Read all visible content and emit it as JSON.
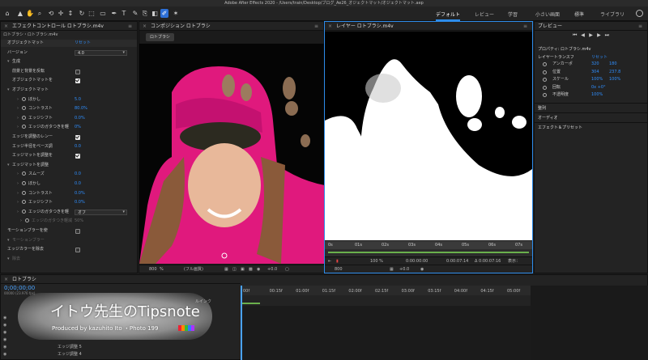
{
  "window": {
    "title": "Adobe After Effects 2020 - /Users/train/Desktop/ブログ_Ae26_オジェクトマット/オジェクトマット.aep"
  },
  "workspaces": [
    "デフォルト",
    "レビュー",
    "学習",
    "小さい画面",
    "標準",
    "ライブラリ"
  ],
  "effect_controls": {
    "tab": "エフェクトコントロール ロトブラシ.m4v",
    "breadcrumb": "ロトブラシ・ロトブラシ.m4v",
    "rows": [
      {
        "label": "オブジェクトマット",
        "value": "リセット",
        "kind": "blue"
      },
      {
        "label": "バージョン",
        "value": "4.0",
        "kind": "dropdown"
      },
      {
        "label": "生成",
        "value": "",
        "kind": "section"
      },
      {
        "label": "前景と背景を反転",
        "value": "",
        "kind": "check-off"
      },
      {
        "label": "オブジェクトマットを",
        "value": "",
        "kind": "check"
      },
      {
        "label": "オブジェクトマット",
        "value": "",
        "kind": "section"
      },
      {
        "label": "ぼかし",
        "value": "5.0",
        "kind": "blue"
      },
      {
        "label": "コントラスト",
        "value": "80.0%",
        "kind": "blue"
      },
      {
        "label": "エッジシフト",
        "value": "0.0%",
        "kind": "blue"
      },
      {
        "label": "エッジのガタつきを軽",
        "value": "0%",
        "kind": "blue"
      },
      {
        "label": "エッジを調整のレンー",
        "value": "",
        "kind": "check"
      },
      {
        "label": "エッジ半径をベース調",
        "value": "0.0",
        "kind": "blue"
      },
      {
        "label": "エッジマットを調整を",
        "value": "",
        "kind": "check"
      },
      {
        "label": "エッジマットを調整",
        "value": "",
        "kind": "section"
      },
      {
        "label": "スムーズ",
        "value": "0.0",
        "kind": "blue"
      },
      {
        "label": "ぼかし",
        "value": "0.0",
        "kind": "blue"
      },
      {
        "label": "コントラスト",
        "value": "0.0%",
        "kind": "blue"
      },
      {
        "label": "エッジシフト",
        "value": "0.0%",
        "kind": "blue"
      },
      {
        "label": "エッジのガタつきを軽",
        "value": "オフ",
        "kind": "dropdown"
      },
      {
        "label": "エッジのガタつき軽減",
        "value": "50%",
        "kind": "dim"
      },
      {
        "label": "モーションブラーを使",
        "value": "",
        "kind": "check-off"
      },
      {
        "label": "モーションブラー",
        "value": "",
        "kind": "dimsection"
      },
      {
        "label": "エッジカラーを除去",
        "value": "",
        "kind": "check-off"
      },
      {
        "label": "除去",
        "value": "",
        "kind": "dimsection"
      }
    ]
  },
  "composition": {
    "tab": "コンポジション ロトブラシ",
    "sub_tab": "ロトブラシ",
    "zoom": "800",
    "zoom_unit": "%",
    "quality": "(フル画質)",
    "exposure": "+0.0"
  },
  "layer_viewer": {
    "tab": "レイヤー ロトブラシ.m4v",
    "ruler": [
      "0s",
      "01s",
      "02s",
      "03s",
      "04s",
      "05s",
      "06s",
      "07s"
    ],
    "timecode_start": "0:00:00:00",
    "timecode_in": "0:00:07:14",
    "timecode_dur": "Δ 0:00:07:16",
    "view_label": "表示：",
    "zoom": "800",
    "zoom_pct": "100 %",
    "exposure": "+0.0"
  },
  "preview": {
    "tab": "プレビュー"
  },
  "properties": {
    "header": "プロパティ: ロトブラシ.m4v",
    "section": "レイヤートランスフ",
    "reset": "リセット",
    "rows": [
      {
        "label": "アンカーポ",
        "v1": "320",
        "v2": "180"
      },
      {
        "label": "位置",
        "v1": "304",
        "v2": "237.8"
      },
      {
        "label": "スケール",
        "v1": "100%",
        "v2": "100%"
      },
      {
        "label": "回転",
        "v1": "0x +0°",
        "v2": ""
      },
      {
        "label": "不透明度",
        "v1": "100%",
        "v2": ""
      }
    ],
    "panels": [
      "整列",
      "オーディオ",
      "エフェクト＆プリセット"
    ]
  },
  "timeline": {
    "tab": "ロトブラシ",
    "timecode": "0;00;00;00",
    "frame_info": "00000 (23.976 fps)",
    "ruler": [
      "00f",
      "00:15f",
      "01:00f",
      "01:15f",
      "02:00f",
      "02:15f",
      "03:00f",
      "03:15f",
      "04:00f",
      "04:15f",
      "05:00f"
    ],
    "layers": [
      "エッジ調整 5",
      "エッジ調整 4"
    ],
    "column_label": "ルインク"
  },
  "watermark": {
    "title": "イトウ先生のTipsnote",
    "subtitle": "Produced by kazuhito Ito ・Photo 199"
  },
  "colors": {
    "accent": "#2d8ceb",
    "value_blue": "#2f8fff",
    "panel": "#232323"
  }
}
